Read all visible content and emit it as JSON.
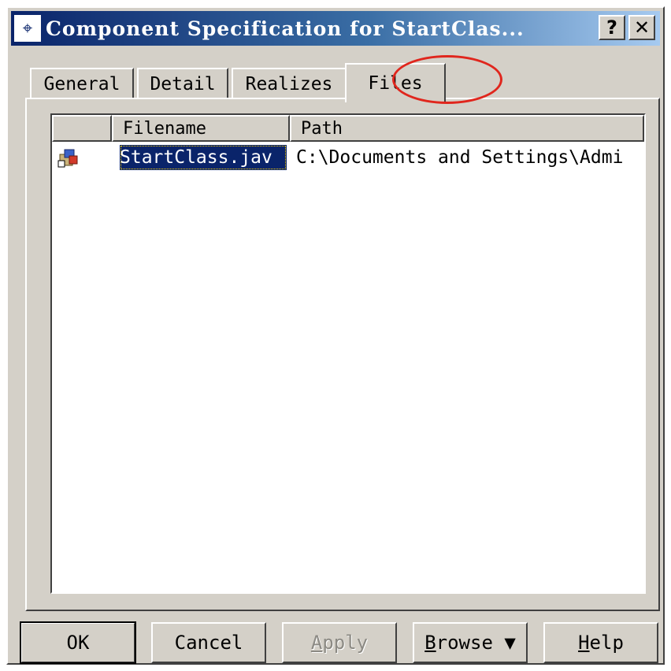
{
  "window": {
    "title": "Component Specification for StartClas...",
    "help_button": "?",
    "close_button": "✕"
  },
  "tabs": [
    {
      "label": "General"
    },
    {
      "label": "Detail"
    },
    {
      "label": "Realizes"
    },
    {
      "label": "Files",
      "active": true
    }
  ],
  "files_list": {
    "columns": [
      "",
      "Filename",
      "Path"
    ],
    "rows": [
      {
        "icon": "file-icon",
        "filename": "StartClass.jav",
        "path": "C:\\Documents and Settings\\Admi",
        "selected": true
      }
    ]
  },
  "buttons": {
    "ok": "OK",
    "cancel": "Cancel",
    "apply": {
      "accel": "A",
      "rest": "pply"
    },
    "browse": {
      "accel": "B",
      "rest": "rowse ▼"
    },
    "help": {
      "accel": "H",
      "rest": "elp"
    }
  },
  "colors": {
    "title_bar": "#0a246a",
    "selection": "#0a246a",
    "annotation": "#e0261d"
  }
}
